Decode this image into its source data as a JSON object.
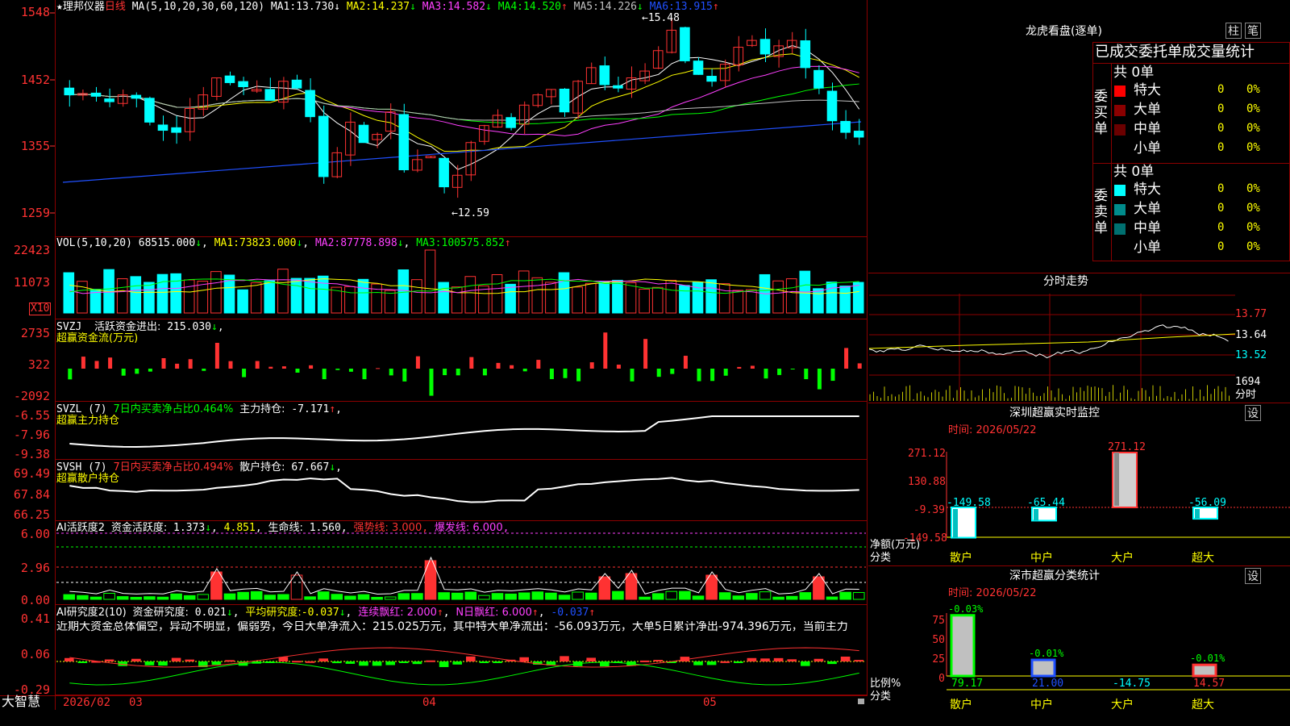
{
  "colors": {
    "up": "#ff3232",
    "down": "#00ffff",
    "grid": "#8b0000",
    "ma1": "#ffffff",
    "ma2": "#ffff00",
    "ma3": "#ff40ff",
    "ma4": "#00ff00",
    "ma5": "#c0c0c0",
    "ma6": "#2050ff"
  },
  "main": {
    "star": "★",
    "stock_name": "理邦仪器",
    "period": "日线",
    "ma_label": "MA(5,10,20,30,60,120)",
    "ma_values": [
      {
        "label": "MA1:",
        "value": "13.730",
        "arrow": "↓"
      },
      {
        "label": "MA2:",
        "value": "14.237",
        "arrow": "↓"
      },
      {
        "label": "MA3:",
        "value": "14.582",
        "arrow": "↓"
      },
      {
        "label": "MA4:",
        "value": "14.520",
        "arrow": "↑"
      },
      {
        "label": "MA5:",
        "value": "14.226",
        "arrow": "↓"
      },
      {
        "label": "MA6:",
        "value": "13.915",
        "arrow": "↑"
      }
    ],
    "y_ticks": [
      "1548",
      "1452",
      "1355",
      "1259"
    ],
    "high_label": "15.48",
    "low_label": "12.59"
  },
  "vol": {
    "title": "VOL(5,10,20)",
    "value": "68515.000",
    "arrow": "↓",
    "ma": [
      {
        "label": "MA1:",
        "value": "73823.000",
        "arrow": "↓"
      },
      {
        "label": "MA2:",
        "value": "87778.898",
        "arrow": "↓"
      },
      {
        "label": "MA3:",
        "value": "100575.852",
        "arrow": "↑"
      }
    ],
    "y_ticks": [
      "22423",
      "11073"
    ],
    "unit": "X10"
  },
  "svzj": {
    "title": "SVZJ",
    "name": "活跃资金进出:",
    "value": "215.030",
    "arrow": "↓",
    "sub": "超赢资金流(万元)",
    "y_ticks": [
      "2735",
      "322",
      "-2092"
    ]
  },
  "svzl": {
    "title": "SVZL (7)",
    "desc": "7日内买卖净占比0.464%",
    "name": "主力持仓:",
    "value": "-7.171",
    "arrow": "↑",
    "sub": "超赢主力持仓",
    "y_ticks": [
      "-6.55",
      "-7.96",
      "-9.38"
    ]
  },
  "svsh": {
    "title": "SVSH (7)",
    "desc": "7日内买卖净占比0.494%",
    "name": "散户持仓:",
    "value": "67.667",
    "arrow": "↓",
    "sub": "超赢散户持仓",
    "y_ticks": [
      "69.49",
      "67.84",
      "66.25"
    ]
  },
  "ai1": {
    "title": "AI活跃度2",
    "name": "资金活跃度:",
    "v1": "1.373",
    "a1": "↓",
    "v2": "4.851",
    "a2": ",",
    "life_label": "生命线:",
    "life": "1.560",
    "strong": "强势线: 3.000",
    "burst": "爆发线: 6.000",
    "y_ticks": [
      "6.00",
      "2.96",
      "0.00"
    ]
  },
  "ai2": {
    "title": "AI研究度2(10)",
    "name": "资金研究度:",
    "v1": "0.021",
    "a1": "↓",
    "avg_label": "平均研究度:",
    "avg": "-0.037",
    "a2": "↓",
    "lx": "连续飘红: 2.000",
    "lx_a": "↑",
    "nr": "N日飘红: 6.000",
    "nr_a": "↑",
    "v3": "-0.037",
    "a3": "↑",
    "comment": "近期大资金总体偏空，异动不明显，偏弱势，今日大单净流入：215.025万元，其中特大单净流出：-56.093万元，大单5日累计净出-974.396万元，当前主力",
    "y_ticks": [
      "0.41",
      "0.06",
      "-0.29"
    ]
  },
  "bottom": {
    "brand": "大智慧",
    "date": "2026/02",
    "m3": "03",
    "m4": "04",
    "m5": "05"
  },
  "right": {
    "dragon": {
      "title": "龙虎看盘(逐单)",
      "btn1": "柱",
      "btn2": "笔",
      "header": "已成交委托单成交量统计",
      "buy_label": "委买单",
      "sell_label": "委卖单",
      "buy_total": "共 0单",
      "sell_total": "共 0单",
      "buy_rows": [
        {
          "name": "特大",
          "count": "0",
          "pct": "0%",
          "color": "#ff0000"
        },
        {
          "name": "大单",
          "count": "0",
          "pct": "0%",
          "color": "#8b0000"
        },
        {
          "name": "中单",
          "count": "0",
          "pct": "0%",
          "color": "#6b0000"
        },
        {
          "name": "小单",
          "count": "0",
          "pct": "0%",
          "color": ""
        }
      ],
      "sell_rows": [
        {
          "name": "特大",
          "count": "0",
          "pct": "0%",
          "color": "#00ffff"
        },
        {
          "name": "大单",
          "count": "0",
          "pct": "0%",
          "color": "#008b8b"
        },
        {
          "name": "中单",
          "count": "0",
          "pct": "0%",
          "color": "#007070"
        },
        {
          "name": "小单",
          "count": "0",
          "pct": "0%",
          "color": ""
        }
      ]
    },
    "intraday": {
      "title": "分时走势",
      "ticks": [
        "13.77",
        "13.64",
        "13.52"
      ],
      "vol_tick": "1694",
      "unit": "分时"
    },
    "sz_monitor": {
      "title": "深圳超赢实时监控",
      "btn": "设",
      "time_label": "时间:",
      "time": "2026/05/22",
      "y_ticks": [
        "271.12",
        "130.88",
        "-9.39",
        "-149.58"
      ],
      "ylabel": "净额(万元)",
      "xlabel": "分类",
      "chart_data": {
        "type": "bar",
        "categories": [
          "散户",
          "中户",
          "大户",
          "超大"
        ],
        "values": [
          -149.58,
          -65.44,
          271.12,
          -56.09
        ]
      }
    },
    "sz_class": {
      "title": "深市超赢分类统计",
      "btn": "设",
      "time_label": "时间:",
      "time": "2026/05/22",
      "y_ticks": [
        "75",
        "50",
        "25",
        "0"
      ],
      "ylabel": "比例%",
      "xlabel": "分类",
      "chart_data": {
        "type": "bar",
        "categories": [
          "散户",
          "中户",
          "大户",
          "超大"
        ],
        "values": [
          79.17,
          21.0,
          -14.75,
          14.57
        ],
        "delta": [
          "-0.03%",
          "-0.01%",
          "",
          "-0.01%"
        ]
      }
    }
  }
}
